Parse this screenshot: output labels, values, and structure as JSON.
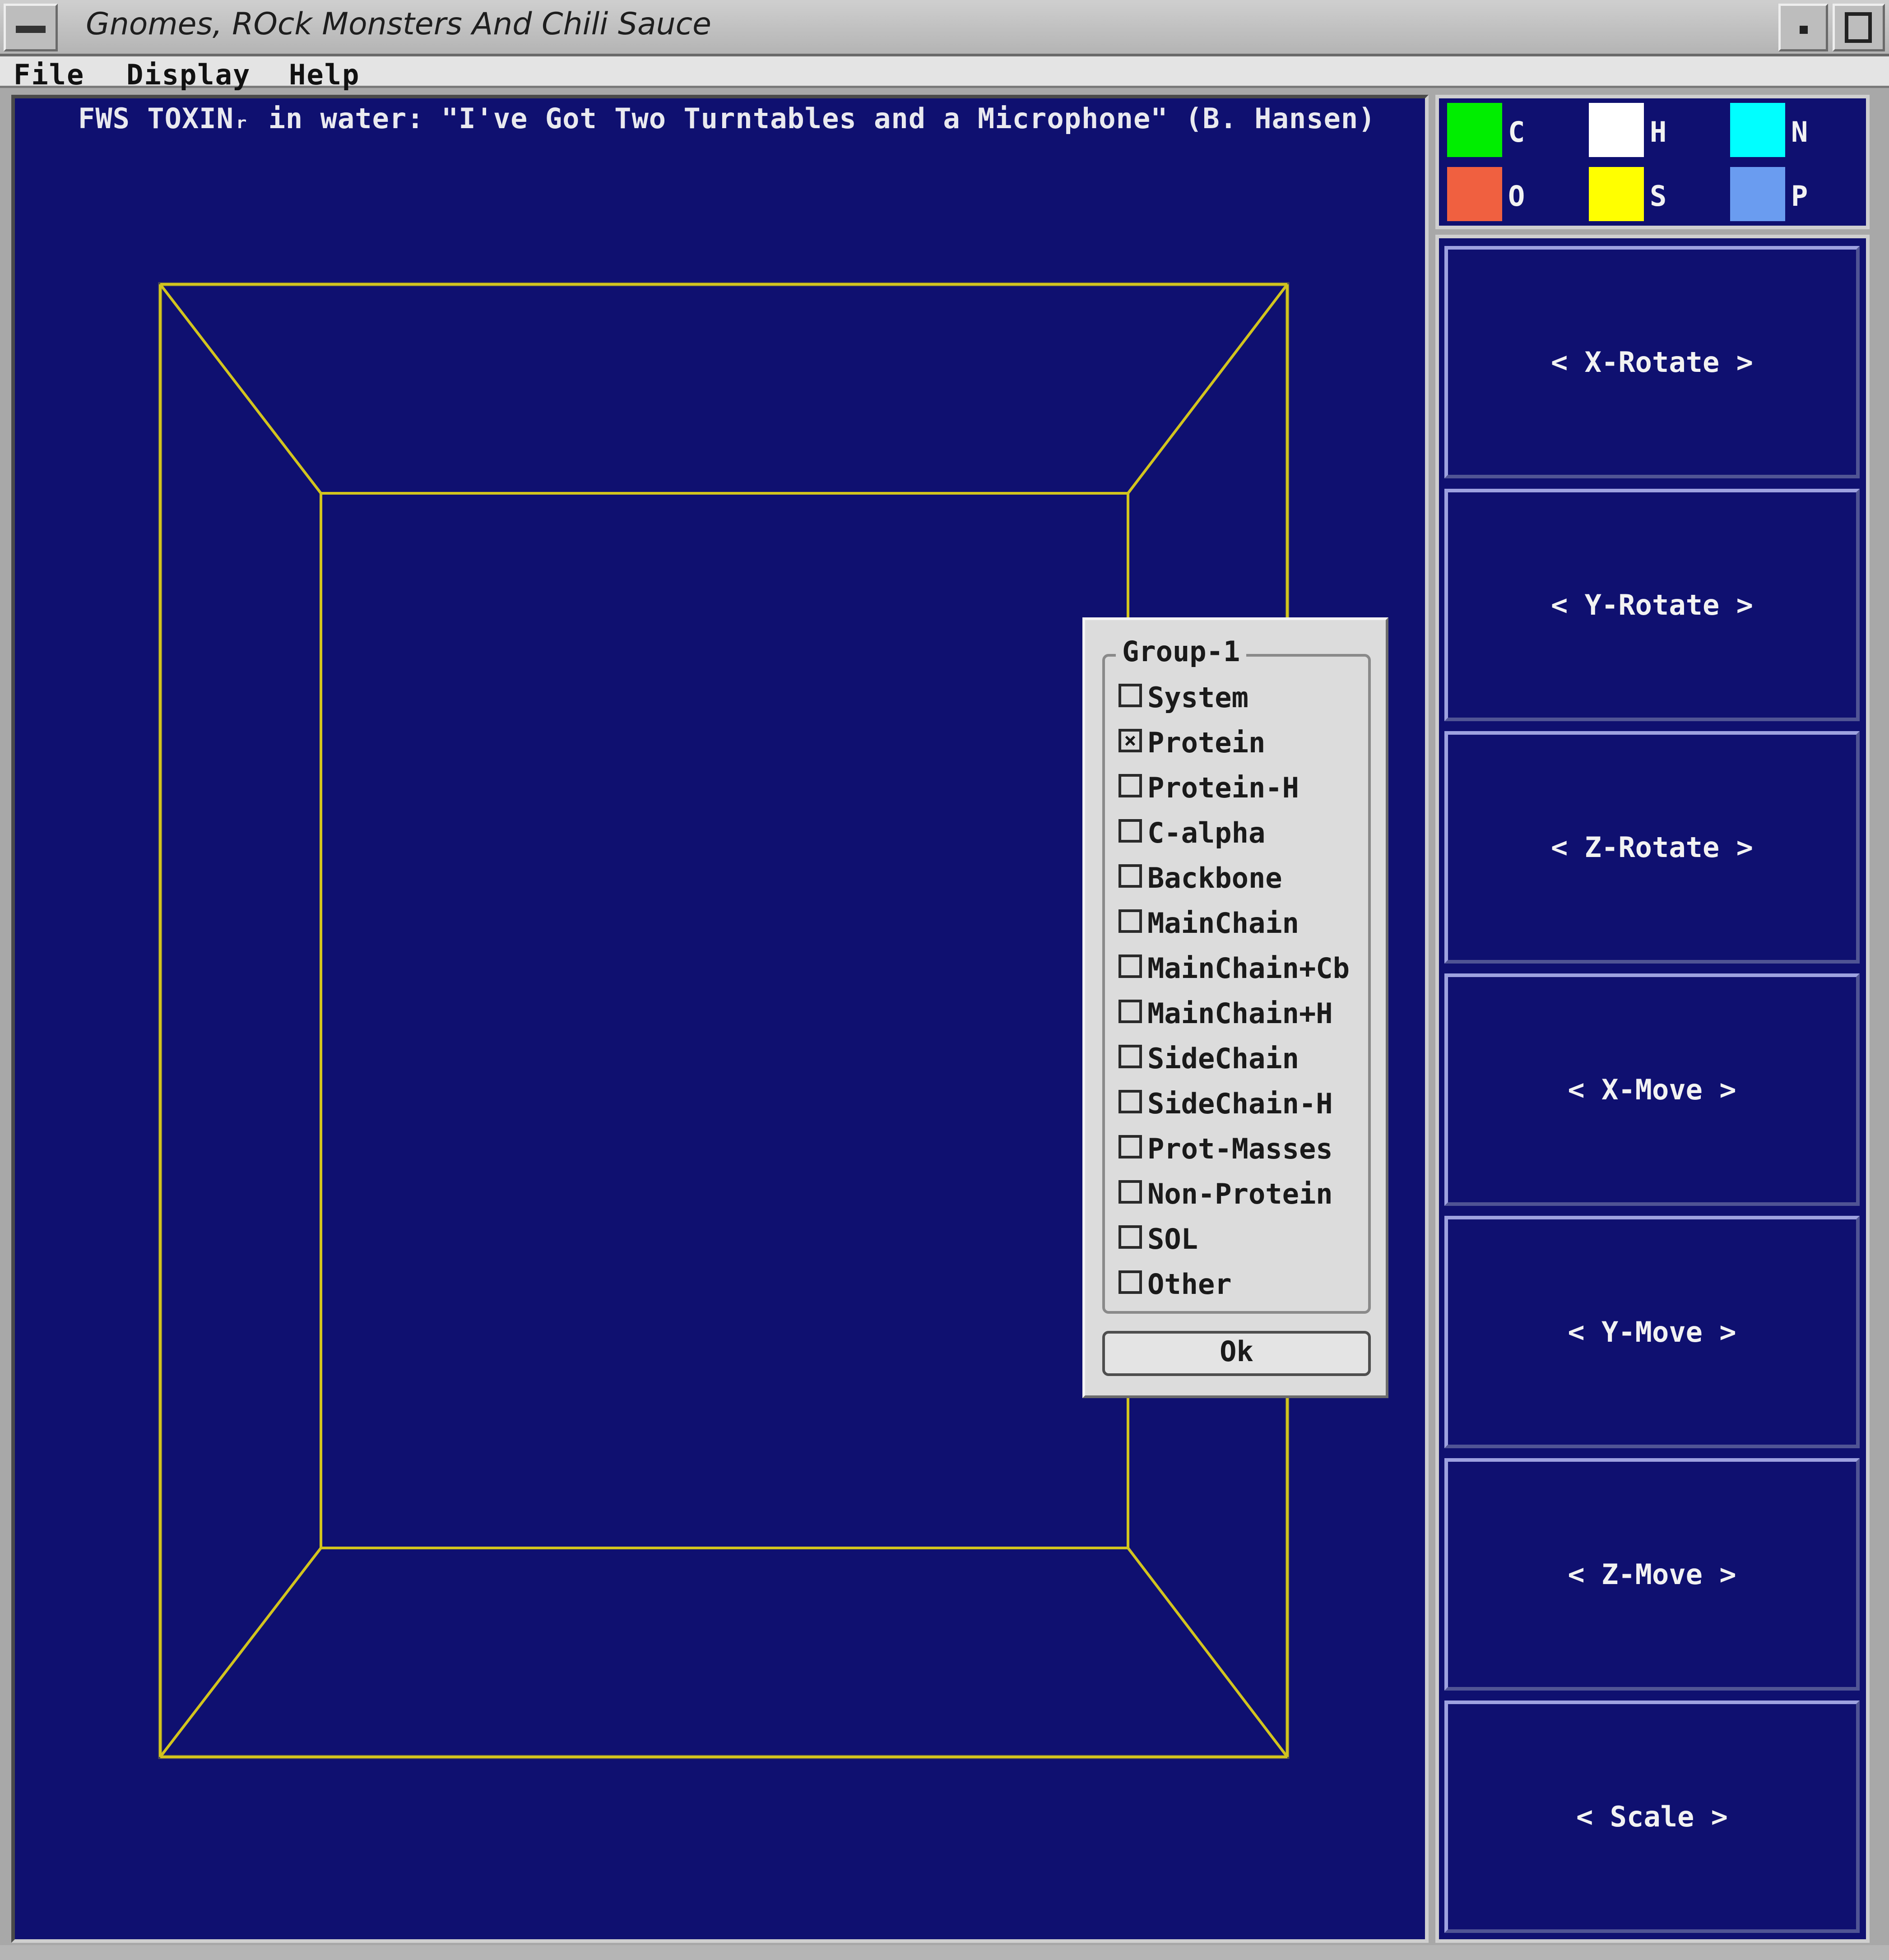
{
  "window": {
    "title": "Gnomes, ROck Monsters And Chili Sauce"
  },
  "menu": {
    "items": [
      "File",
      "Display",
      "Help"
    ]
  },
  "canvas": {
    "caption": "FWS TOXINᵣ in water: \"I've Got Two Turntables and a Microphone\" (B. Hansen)",
    "background": "#0f1070",
    "wire_color": "#d2c41e"
  },
  "legend": [
    {
      "label": "C",
      "color": "#00ee00"
    },
    {
      "label": "H",
      "color": "#ffffff"
    },
    {
      "label": "N",
      "color": "#00ffff"
    },
    {
      "label": "O",
      "color": "#f06040"
    },
    {
      "label": "S",
      "color": "#ffff00"
    },
    {
      "label": "P",
      "color": "#6a9cf0"
    }
  ],
  "controls": [
    {
      "label": "< X-Rotate >"
    },
    {
      "label": "< Y-Rotate >"
    },
    {
      "label": "< Z-Rotate >"
    },
    {
      "label": "< X-Move >"
    },
    {
      "label": "< Y-Move >"
    },
    {
      "label": "< Z-Move >"
    },
    {
      "label": "< Scale >"
    }
  ],
  "dialog": {
    "group_title": "Group-1",
    "options": [
      {
        "label": "System",
        "checked": false
      },
      {
        "label": "Protein",
        "checked": true
      },
      {
        "label": "Protein-H",
        "checked": false
      },
      {
        "label": "C-alpha",
        "checked": false
      },
      {
        "label": "Backbone",
        "checked": false
      },
      {
        "label": "MainChain",
        "checked": false
      },
      {
        "label": "MainChain+Cb",
        "checked": false
      },
      {
        "label": "MainChain+H",
        "checked": false
      },
      {
        "label": "SideChain",
        "checked": false
      },
      {
        "label": "SideChain-H",
        "checked": false
      },
      {
        "label": "Prot-Masses",
        "checked": false
      },
      {
        "label": "Non-Protein",
        "checked": false
      },
      {
        "label": "SOL",
        "checked": false
      },
      {
        "label": "Other",
        "checked": false
      }
    ],
    "ok_label": "Ok"
  }
}
